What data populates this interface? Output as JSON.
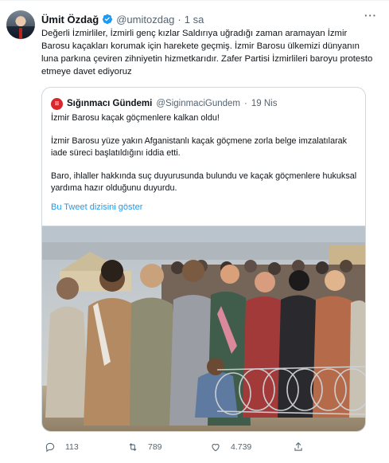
{
  "tweet": {
    "author_name": "Ümit Özdağ",
    "author_handle": "@umitozdag",
    "separator": "·",
    "time": "1 sa",
    "text": "Değerli İzmirliler, İzmirli genç kızlar Saldırıya uğradığı zaman aramayan İzmir Barosu kaçakları korumak için harekete geçmiş. İzmir Barosu ülkemizi dünyanın luna parkına çeviren zihniyetin hizmetkarıdır. Zafer Partisi İzmirlileri baroyu protesto etmeye davet ediyoruz",
    "more_icon": "more-horizontal-icon"
  },
  "quote": {
    "author_name": "Sığınmacı Gündemi",
    "author_handle": "@SiginmaciGundem",
    "separator": "·",
    "time": "19 Nis",
    "logo_letter": "≡",
    "paragraphs": [
      "İzmir Barosu kaçak göçmenlere kalkan oldu!",
      "İzmir Barosu yüze yakın Afganistanlı kaçak göçmene zorla belge imzalatılarak iade süreci başlatıldığını iddia etti.",
      "Baro, ihlaller hakkında suç duyurusunda bulundu ve kaçak göçmenlere hukuksal yardıma hazır olduğunu duyurdu."
    ],
    "thread_link": "Bu Tweet dizisini göster"
  },
  "actions": {
    "replies": "113",
    "retweets": "789",
    "likes": "4.739"
  },
  "colors": {
    "accent": "#1d9bf0",
    "verified": "#1d9bf0",
    "muted_text": "#536471",
    "quote_logo": "#d9262c"
  }
}
